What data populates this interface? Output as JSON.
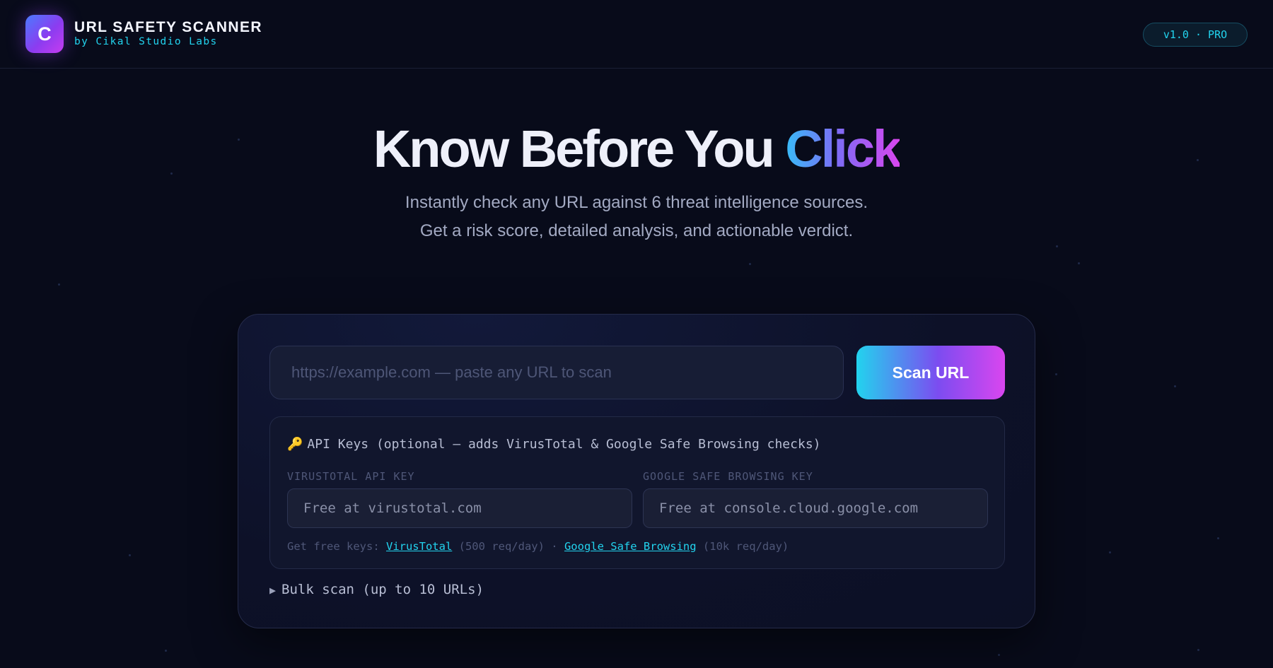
{
  "header": {
    "logo_letter": "C",
    "title": "URL SAFETY SCANNER",
    "subtitle": "by Cikal Studio Labs",
    "version_badge": "v1.0 · PRO"
  },
  "hero": {
    "title_main": "Know Before You ",
    "title_accent": "Click",
    "subtitle_line1": "Instantly check any URL against 6 threat intelligence sources.",
    "subtitle_line2": "Get a risk score, detailed analysis, and actionable verdict."
  },
  "scanner": {
    "url_placeholder": "https://example.com — paste any URL to scan",
    "url_value": "",
    "scan_button_label": "Scan URL"
  },
  "api_keys": {
    "key_icon": "🔑",
    "heading": "API Keys (optional — adds VirusTotal & Google Safe Browsing checks)",
    "virustotal_label": "VIRUSTOTAL API KEY",
    "virustotal_placeholder": "Free at virustotal.com",
    "google_label": "GOOGLE SAFE BROWSING KEY",
    "google_placeholder": "Free at console.cloud.google.com",
    "help_prefix": "Get free keys: ",
    "virustotal_link": "VirusTotal",
    "virustotal_quota": " (500 req/day) · ",
    "google_link": "Google Safe Browsing",
    "google_quota": " (10k req/day)"
  },
  "bulk": {
    "caret_icon": "▶",
    "label": "Bulk scan (up to 10 URLs)"
  },
  "colors": {
    "background": "#080b1a",
    "accent_cyan": "#22d3ee",
    "accent_purple": "#8b3cf0",
    "accent_magenta": "#d946ef"
  }
}
